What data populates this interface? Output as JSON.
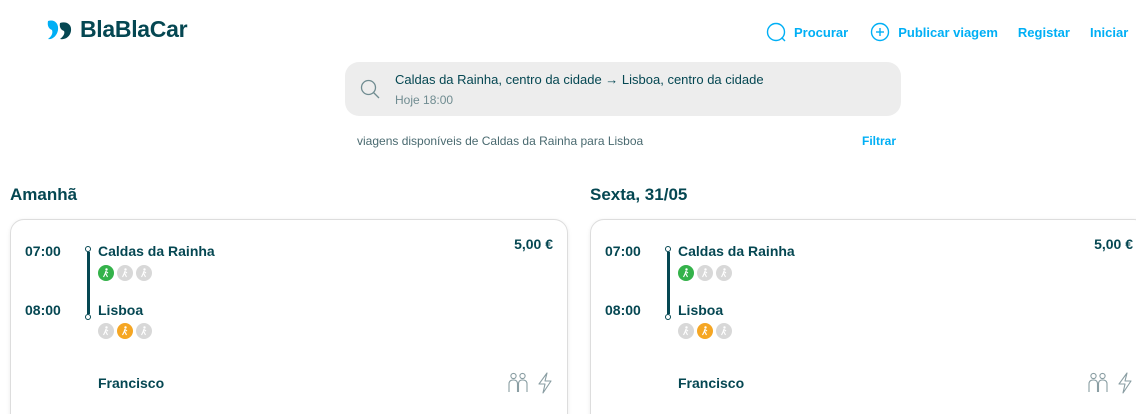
{
  "brand": {
    "name": "BlaBlaCar"
  },
  "nav": {
    "search_label": "Procurar",
    "publish_label": "Publicar viagem",
    "register_label": "Registar",
    "login_label": "Iniciar"
  },
  "search": {
    "route": "Caldas da Rainha, centro da cidade → Lisboa, centro da cidade",
    "when": "Hoje 18:00"
  },
  "results": {
    "info": "viagens disponíveis de Caldas da Rainha para Lisboa",
    "filter_label": "Filtrar"
  },
  "days": [
    {
      "title": "Amanhã",
      "trip": {
        "departure_time": "07:00",
        "departure_city": "Caldas da Rainha",
        "departure_walk": "green",
        "arrival_time": "08:00",
        "arrival_city": "Lisboa",
        "arrival_walk": "orange",
        "price": "5,00 €",
        "driver": "Francisco",
        "features": [
          "max-2-back-icon",
          "instant-booking-icon"
        ]
      }
    },
    {
      "title": "Sexta, 31/05",
      "trip": {
        "departure_time": "07:00",
        "departure_city": "Caldas da Rainha",
        "departure_walk": "green",
        "arrival_time": "08:00",
        "arrival_city": "Lisboa",
        "arrival_walk": "orange",
        "price": "5,00 €",
        "driver": "Francisco",
        "features": [
          "max-2-back-icon",
          "instant-booking-icon"
        ]
      }
    }
  ],
  "colors": {
    "primary": "#054752",
    "accent": "#00aff5",
    "walk_near": "#34b24a",
    "walk_medium": "#f5a623",
    "walk_inactive": "#d8d8d8"
  }
}
